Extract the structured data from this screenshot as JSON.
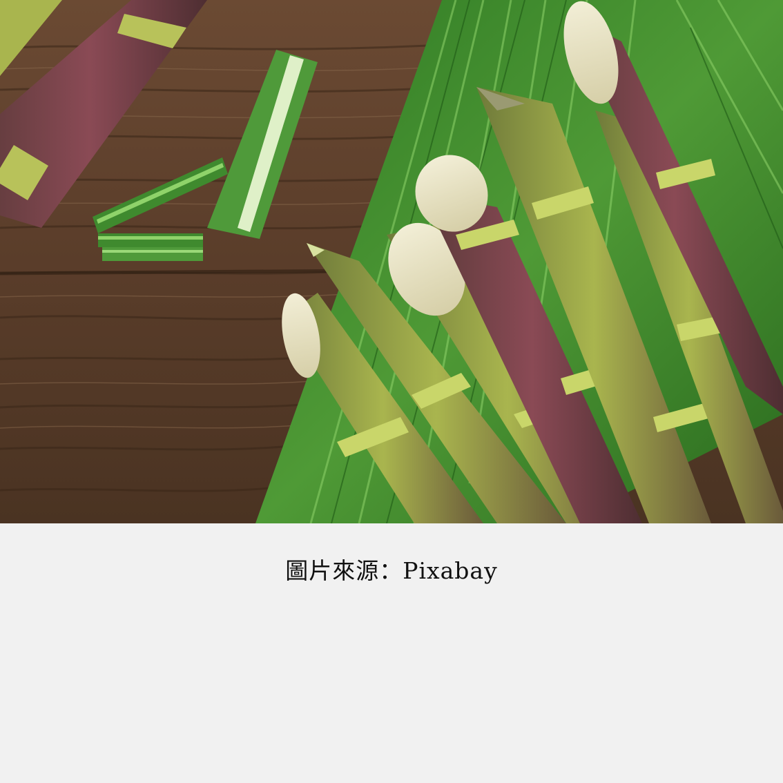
{
  "caption": {
    "text": "圖片來源：Pixabay"
  },
  "photo": {
    "subject_icon": "sugarcane-photo",
    "colors": {
      "wood_dark": "#4a3322",
      "wood_light": "#7a5a40",
      "leaf_green": "#3f8a2e",
      "leaf_light": "#7cc25a",
      "cane_green": "#a7b64a",
      "cane_purple": "#6e3b45",
      "cut_flesh": "#e8e2c4",
      "page_background": "#f1f1f1"
    }
  }
}
